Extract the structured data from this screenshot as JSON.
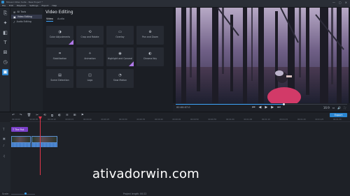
{
  "window": {
    "title": "Movavi Video Suite - New Project *",
    "controls": [
      "—",
      "▢",
      "✕"
    ]
  },
  "menu": [
    "File",
    "Edit",
    "Playback",
    "Settings",
    "Export",
    "Help"
  ],
  "tools": [
    {
      "name": "import",
      "glyph": "⎘"
    },
    {
      "name": "magic-wand",
      "glyph": "✦"
    },
    {
      "name": "filters",
      "glyph": "◧"
    },
    {
      "name": "titles",
      "glyph": "T"
    },
    {
      "name": "transitions",
      "glyph": "⊠"
    },
    {
      "name": "clock",
      "glyph": "◷"
    },
    {
      "name": "video-editing",
      "glyph": "▣"
    }
  ],
  "categories": [
    {
      "label": "All Tools",
      "glyph": "⊞"
    },
    {
      "label": "Video Editing",
      "glyph": "▣"
    },
    {
      "label": "Audio Editing",
      "glyph": "♪"
    }
  ],
  "panel": {
    "title": "Video Editing",
    "tabs": [
      "Video",
      "Audio"
    ],
    "tiles": [
      {
        "label": "Color Adjustments",
        "icon": "◑",
        "pro": true
      },
      {
        "label": "Crop and Rotate",
        "icon": "⟲",
        "pro": false
      },
      {
        "label": "Overlay",
        "icon": "▭",
        "pro": false
      },
      {
        "label": "Pan and Zoom",
        "icon": "⊕",
        "pro": false
      },
      {
        "label": "Stabilization",
        "icon": "⌗",
        "pro": false
      },
      {
        "label": "Animation",
        "icon": "✧",
        "pro": false
      },
      {
        "label": "Highlight and Conceal",
        "icon": "◉",
        "pro": true
      },
      {
        "label": "Chroma Key",
        "icon": "◐",
        "pro": false
      },
      {
        "label": "Scene Detection",
        "icon": "▤",
        "pro": false
      },
      {
        "label": "Logo",
        "icon": "◫",
        "pro": false
      },
      {
        "label": "Slow Motion",
        "icon": "◔",
        "pro": false
      }
    ]
  },
  "player": {
    "timecode": "00:00:07.0",
    "progress": 0.63,
    "controls": [
      "⏮",
      "◀",
      "▶",
      "▶",
      "⏭"
    ],
    "zoom": "16:9",
    "right_icons": [
      "⇔",
      "🔊",
      "⛶"
    ]
  },
  "timeline": {
    "toolbar": [
      "↶",
      "↷",
      "🗑",
      "✂",
      "⟲",
      "⧉",
      "◐",
      "≡",
      "⊞",
      "⚑"
    ],
    "export_label": "Export",
    "ruler": [
      "00:00:00",
      "00:00:05",
      "00:00:10",
      "00:00:15",
      "00:00:20",
      "00:00:25",
      "00:00:30",
      "00:00:35",
      "00:00:40",
      "00:00:45",
      "00:00:50",
      "00:00:55",
      "00:01:00",
      "00:01:05",
      "00:01:10",
      "00:01:15",
      "00:01:20",
      "00:01:25",
      "00:01:30"
    ],
    "title_clip": "T The Fist",
    "scale_label": "Scale:",
    "project_length": "Project length:  00:22"
  },
  "watermark": "ativadorwin.com"
}
